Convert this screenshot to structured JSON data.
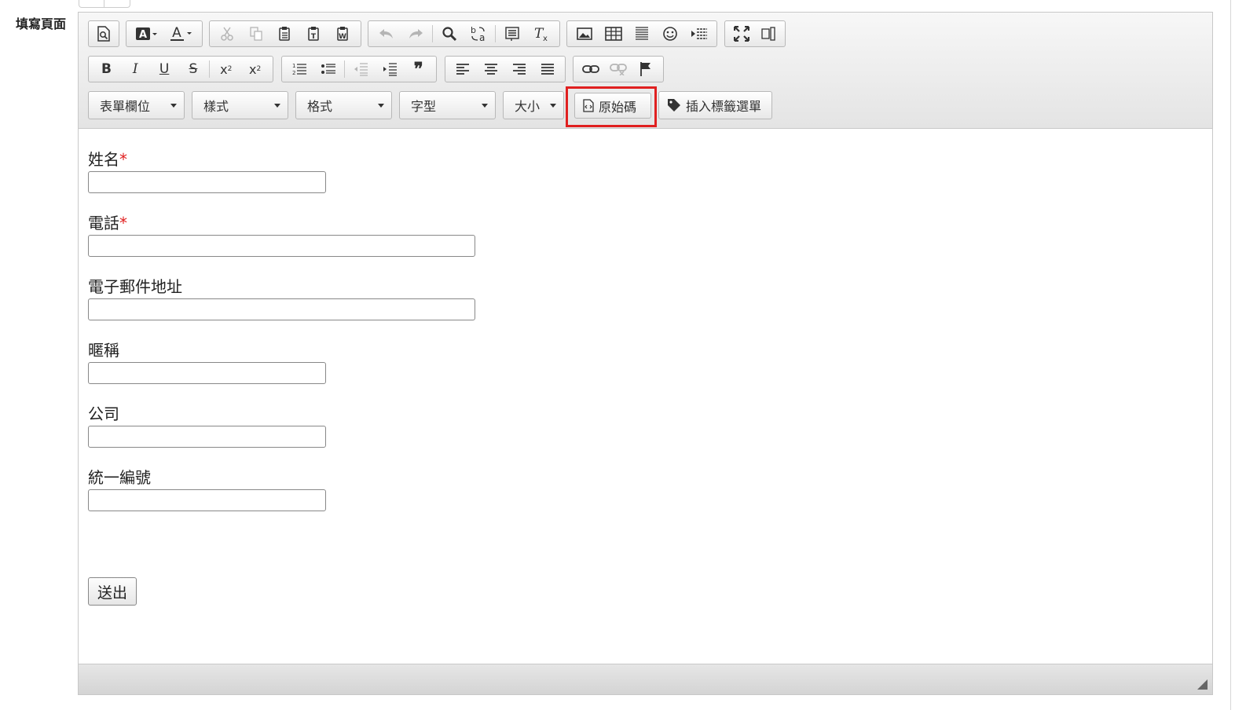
{
  "page_label": "填寫頁面",
  "toolbar": {
    "row1": [
      {
        "icon": "preview-icon",
        "glyph": "🔍"
      },
      {
        "icon": "text-color-icon",
        "glyph": "A▾"
      },
      {
        "icon": "bg-color-icon",
        "glyph": "A▾"
      },
      {
        "icon": "cut-icon",
        "glyph": "✂"
      },
      {
        "icon": "copy-icon",
        "glyph": "⎘"
      },
      {
        "icon": "paste-icon",
        "glyph": "📋"
      },
      {
        "icon": "paste-text-icon",
        "glyph": "📋"
      },
      {
        "icon": "paste-word-icon",
        "glyph": "📋"
      },
      {
        "icon": "undo-icon",
        "glyph": "↶"
      },
      {
        "icon": "redo-icon",
        "glyph": "↷"
      },
      {
        "icon": "find-icon",
        "glyph": "🔍"
      },
      {
        "icon": "replace-icon",
        "glyph": "b↔a"
      },
      {
        "icon": "select-all-icon",
        "glyph": "▤"
      },
      {
        "icon": "remove-format-icon",
        "glyph": "Tx"
      },
      {
        "icon": "image-icon",
        "glyph": "🖼"
      },
      {
        "icon": "table-icon",
        "glyph": "▦"
      },
      {
        "icon": "horizontal-rule-icon",
        "glyph": "≡"
      },
      {
        "icon": "smiley-icon",
        "glyph": "☺"
      },
      {
        "icon": "page-break-icon",
        "glyph": "⇥"
      },
      {
        "icon": "maximize-icon",
        "glyph": "⤢"
      },
      {
        "icon": "show-blocks-icon",
        "glyph": "▯"
      }
    ],
    "row2": [
      {
        "icon": "bold-icon",
        "glyph": "B"
      },
      {
        "icon": "italic-icon",
        "glyph": "I"
      },
      {
        "icon": "underline-icon",
        "glyph": "U"
      },
      {
        "icon": "strike-icon",
        "glyph": "S"
      },
      {
        "icon": "subscript-icon",
        "glyph": "x₂"
      },
      {
        "icon": "superscript-icon",
        "glyph": "x²"
      },
      {
        "icon": "numbered-list-icon",
        "glyph": "⒈"
      },
      {
        "icon": "bulleted-list-icon",
        "glyph": "•"
      },
      {
        "icon": "outdent-icon",
        "glyph": "⇤"
      },
      {
        "icon": "indent-icon",
        "glyph": "⇥"
      },
      {
        "icon": "blockquote-icon",
        "glyph": "❞"
      },
      {
        "icon": "align-left-icon",
        "glyph": "≡"
      },
      {
        "icon": "align-center-icon",
        "glyph": "≡"
      },
      {
        "icon": "align-right-icon",
        "glyph": "≡"
      },
      {
        "icon": "justify-icon",
        "glyph": "≡"
      },
      {
        "icon": "link-icon",
        "glyph": "∞"
      },
      {
        "icon": "unlink-icon",
        "glyph": "∞"
      },
      {
        "icon": "anchor-icon",
        "glyph": "⚑"
      }
    ],
    "combos": {
      "form_fields": "表單欄位",
      "styles": "樣式",
      "format": "格式",
      "font": "字型",
      "size": "大小"
    },
    "source_button": "原始碼",
    "insert_tag_menu": "插入標籤選單"
  },
  "form": {
    "fields": [
      {
        "label": "姓名",
        "required": true
      },
      {
        "label": "電話",
        "required": true
      },
      {
        "label": "電子郵件地址",
        "required": false
      },
      {
        "label": "暱稱",
        "required": false
      },
      {
        "label": "公司",
        "required": false
      },
      {
        "label": "統一編號",
        "required": false
      }
    ],
    "required_mark": "*",
    "submit_label": "送出"
  },
  "colors": {
    "highlight": "#e02020",
    "required": "#e02020"
  }
}
